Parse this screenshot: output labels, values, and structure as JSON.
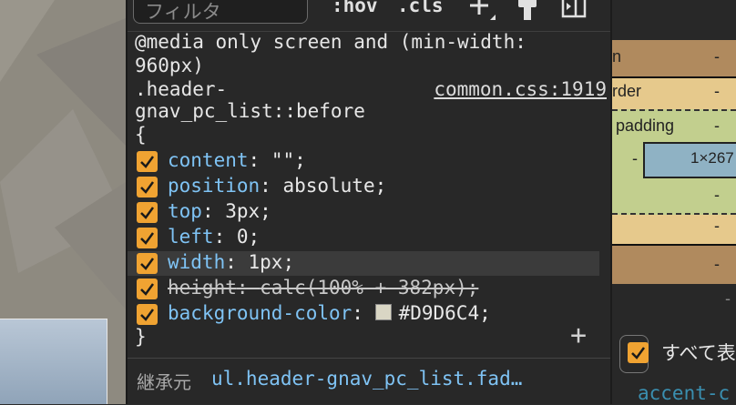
{
  "toolbar": {
    "filter_placeholder": "フィルタ",
    "hov_label": ":hov",
    "cls_label": ".cls"
  },
  "rule": {
    "media_line1": "@media only screen and (min-width:",
    "media_line2": "960px)",
    "selector_line1": ".header-",
    "selector_line2": "gnav_pc_list::before",
    "open_brace": "{",
    "close_brace": "}",
    "source": "common.css:1919",
    "declarations": [
      {
        "prop": "content",
        "value": "\"\";",
        "checked": true,
        "overridden": false
      },
      {
        "prop": "position",
        "value": "absolute;",
        "checked": true,
        "overridden": false
      },
      {
        "prop": "top",
        "value": "3px;",
        "checked": true,
        "overridden": false
      },
      {
        "prop": "left",
        "value": "0;",
        "checked": true,
        "overridden": false
      },
      {
        "prop": "width",
        "value": "1px;",
        "checked": true,
        "overridden": false
      },
      {
        "prop": "height",
        "value": "calc(100% + 382px);",
        "checked": true,
        "overridden": true
      },
      {
        "prop": "background-color",
        "value": "#D9D6C4;",
        "checked": true,
        "overridden": false,
        "swatch": "#D9D6C4"
      }
    ]
  },
  "inherited": {
    "label": "継承元",
    "selector": "ul.header-gnav_pc_list.fad…"
  },
  "box_model": {
    "margin_label": "n",
    "border_label": "rder",
    "padding_label": "padding",
    "content_size": "1×267",
    "dash": "-"
  },
  "computed": {
    "show_all_label": "すべて表",
    "accent_text": "accent-c"
  },
  "colors": {
    "checkbox": "#f0a332",
    "property": "#7fc3f4",
    "margin": "#b08a5e",
    "border": "#e6c98c",
    "padding": "#c2cf8e",
    "content": "#8fb2c4"
  }
}
